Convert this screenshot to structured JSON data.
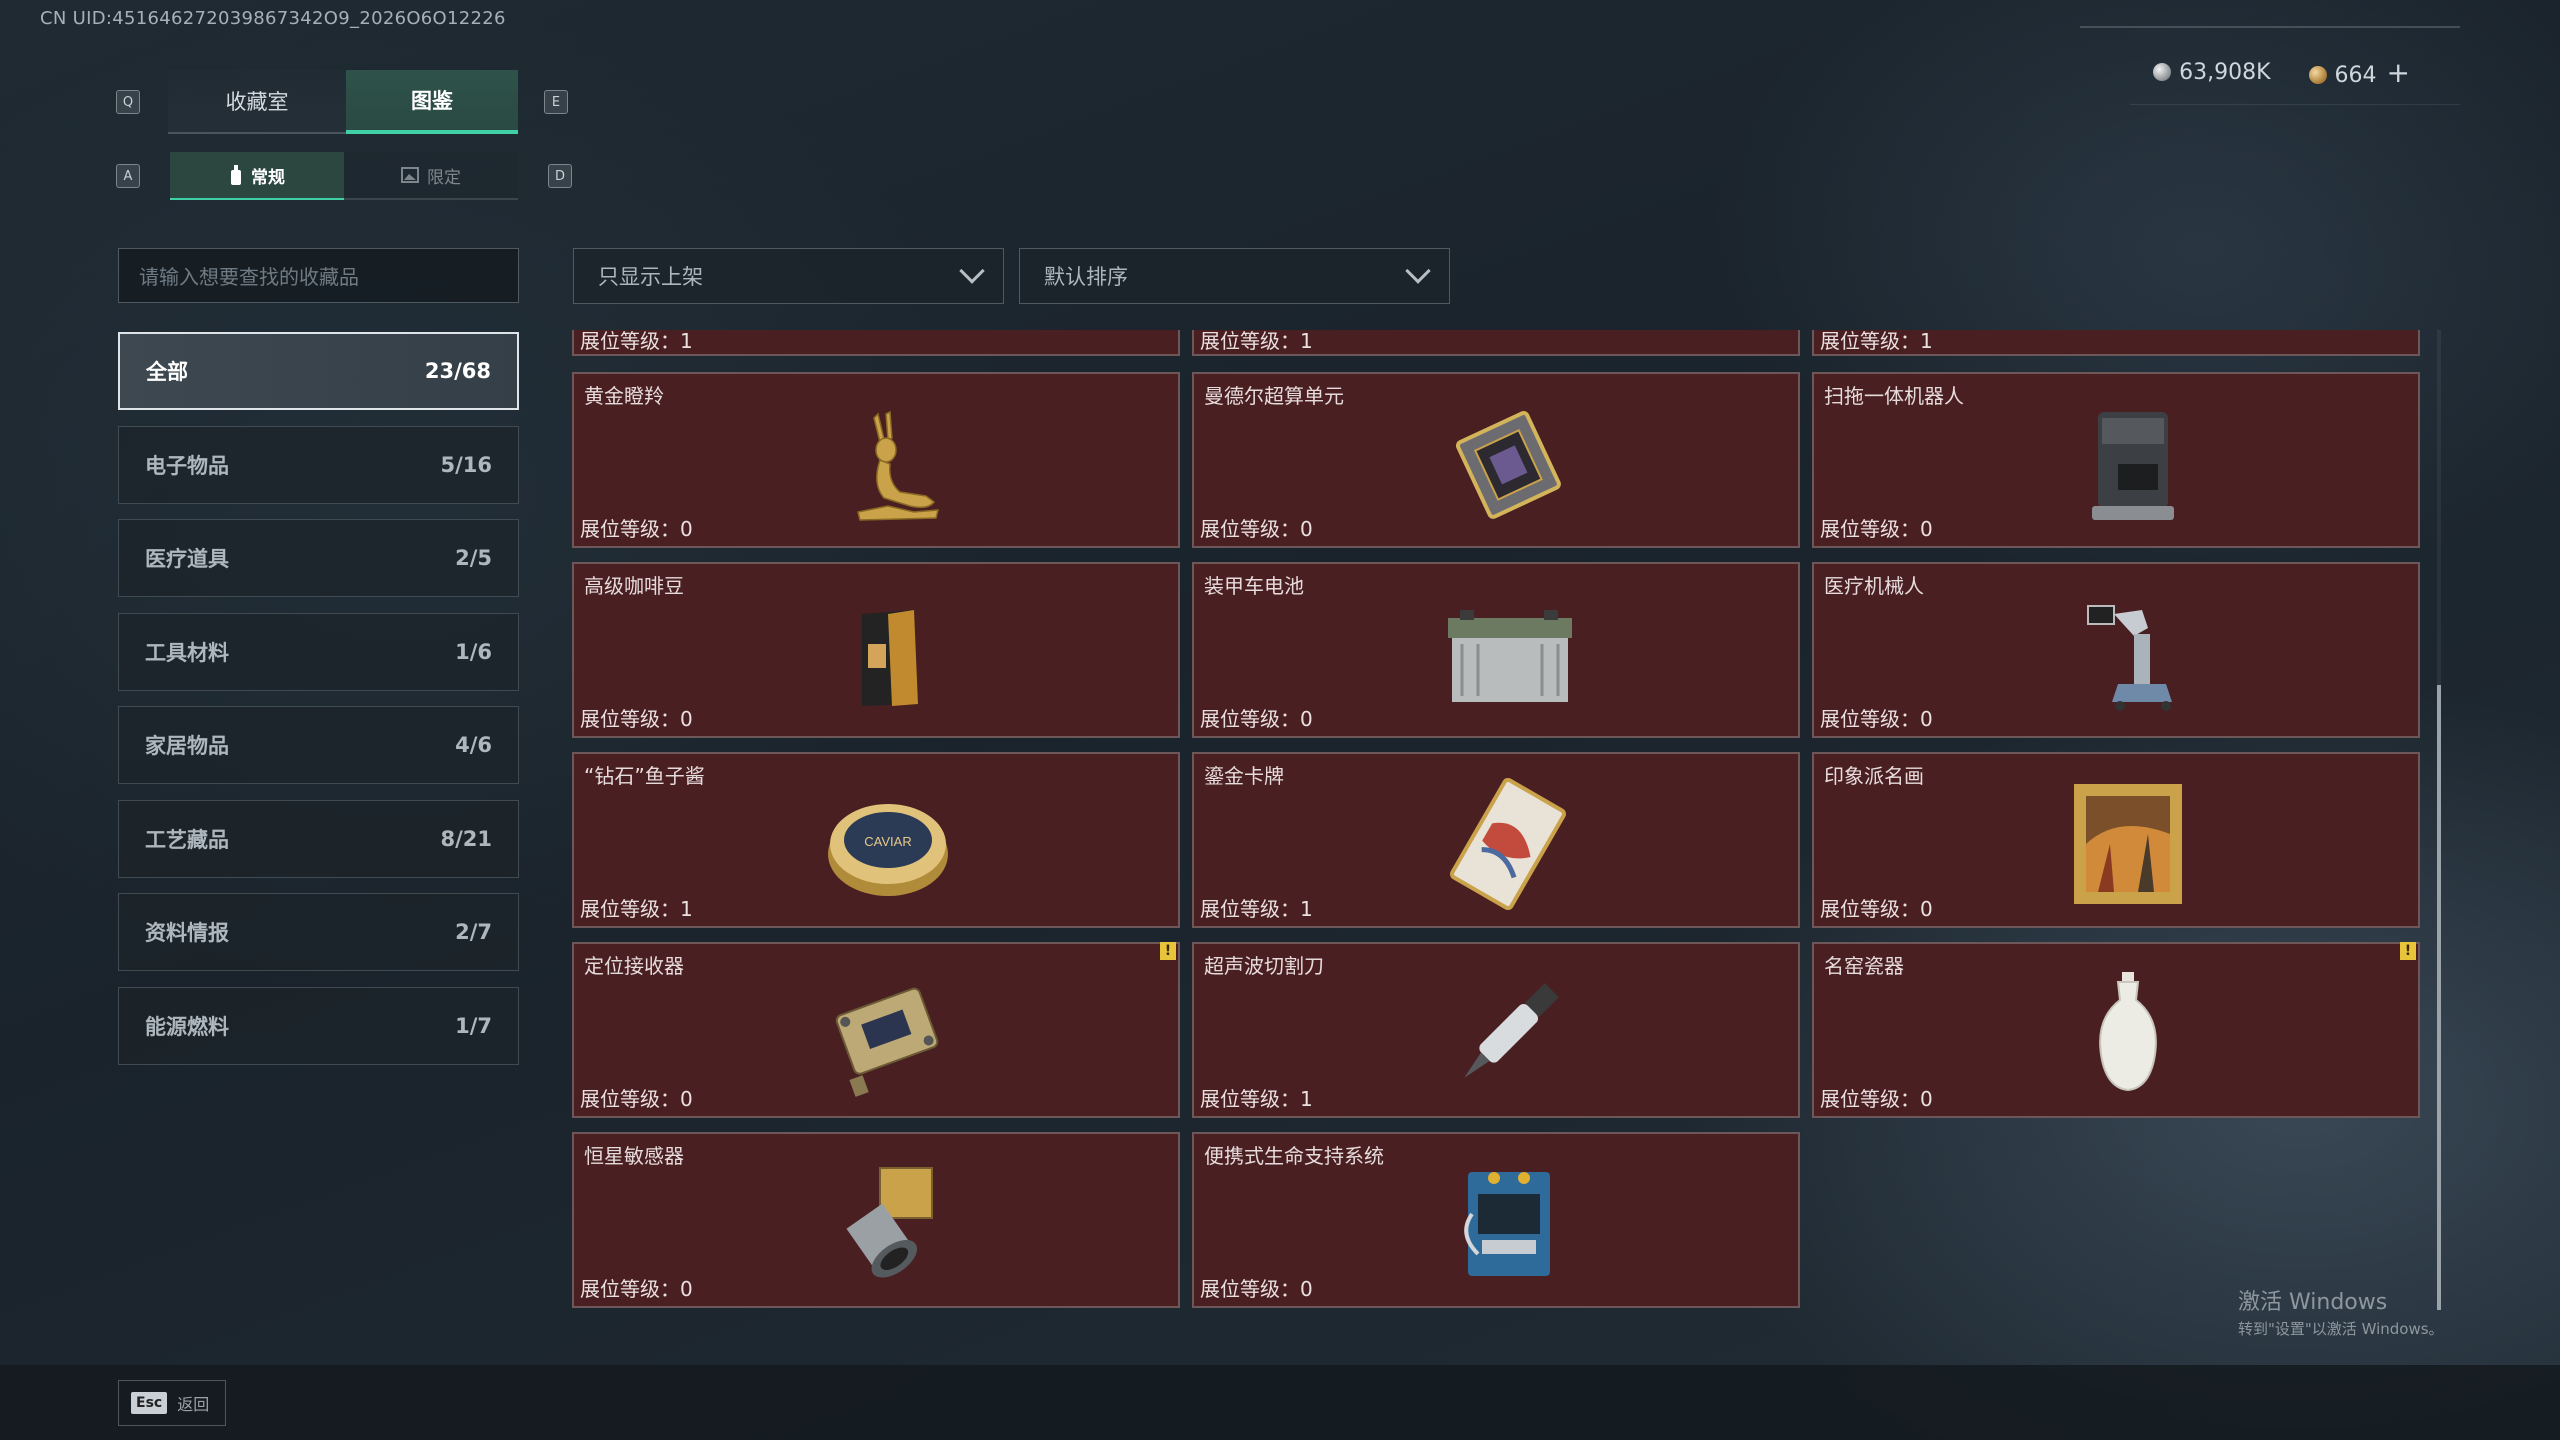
{
  "uid": "CN UID:451646272039867342O9_2026O6O12226",
  "keys": {
    "prev_tab": "Q",
    "next_tab": "E",
    "prev_sub": "A",
    "next_sub": "D"
  },
  "tabs": [
    {
      "label": "收藏室",
      "active": false
    },
    {
      "label": "图鉴",
      "active": true
    }
  ],
  "subtabs": [
    {
      "label": "常规",
      "active": true
    },
    {
      "label": "限定",
      "active": false
    }
  ],
  "currency": {
    "silver": "63,908K",
    "gold": "664",
    "plus": "+"
  },
  "search": {
    "placeholder": "请输入想要查找的收藏品"
  },
  "filters": {
    "shelf": "只显示上架",
    "sort": "默认排序"
  },
  "categories": [
    {
      "label": "全部",
      "count": "23/68",
      "active": true
    },
    {
      "label": "电子物品",
      "count": "5/16"
    },
    {
      "label": "医疗道具",
      "count": "2/5"
    },
    {
      "label": "工具材料",
      "count": "1/6"
    },
    {
      "label": "家居物品",
      "count": "4/6"
    },
    {
      "label": "工艺藏品",
      "count": "8/21"
    },
    {
      "label": "资料情报",
      "count": "2/7"
    },
    {
      "label": "能源燃料",
      "count": "1/7"
    }
  ],
  "partial_row": [
    "展位等级：1",
    "展位等级：1",
    "展位等级：1"
  ],
  "items": [
    {
      "name": "黄金瞪羚",
      "level": "展位等级：0",
      "icon": "golden-gazelle"
    },
    {
      "name": "曼德尔超算单元",
      "level": "展位等级：0",
      "icon": "supercomputer-chip"
    },
    {
      "name": "扫拖一体机器人",
      "level": "展位等级：0",
      "icon": "mop-robot"
    },
    {
      "name": "高级咖啡豆",
      "level": "展位等级：0",
      "icon": "coffee-bag"
    },
    {
      "name": "装甲车电池",
      "level": "展位等级：0",
      "icon": "vehicle-battery"
    },
    {
      "name": "医疗机械人",
      "level": "展位等级：0",
      "icon": "medical-robot"
    },
    {
      "name": "“钻石”鱼子酱",
      "level": "展位等级：1",
      "icon": "caviar-tin"
    },
    {
      "name": "鎏金卡牌",
      "level": "展位等级：1",
      "icon": "gilded-card"
    },
    {
      "name": "印象派名画",
      "level": "展位等级：0",
      "icon": "framed-painting"
    },
    {
      "name": "定位接收器",
      "level": "展位等级：0",
      "icon": "gps-receiver",
      "warning": true
    },
    {
      "name": "超声波切割刀",
      "level": "展位等级：1",
      "icon": "ultrasonic-knife"
    },
    {
      "name": "名窑瓷器",
      "level": "展位等级：0",
      "icon": "porcelain-vase",
      "warning": true
    },
    {
      "name": "恒星敏感器",
      "level": "展位等级：0",
      "icon": "star-sensor"
    },
    {
      "name": "便携式生命支持系统",
      "level": "展位等级：0",
      "icon": "life-support-system"
    }
  ],
  "caviar_text": "CAVIAR",
  "warning_mark": "!",
  "footer": {
    "esc_key": "Esc",
    "esc_label": "返回"
  },
  "activation": {
    "line1": "激活 Windows",
    "line2": "转到\"设置\"以激活 Windows。"
  }
}
